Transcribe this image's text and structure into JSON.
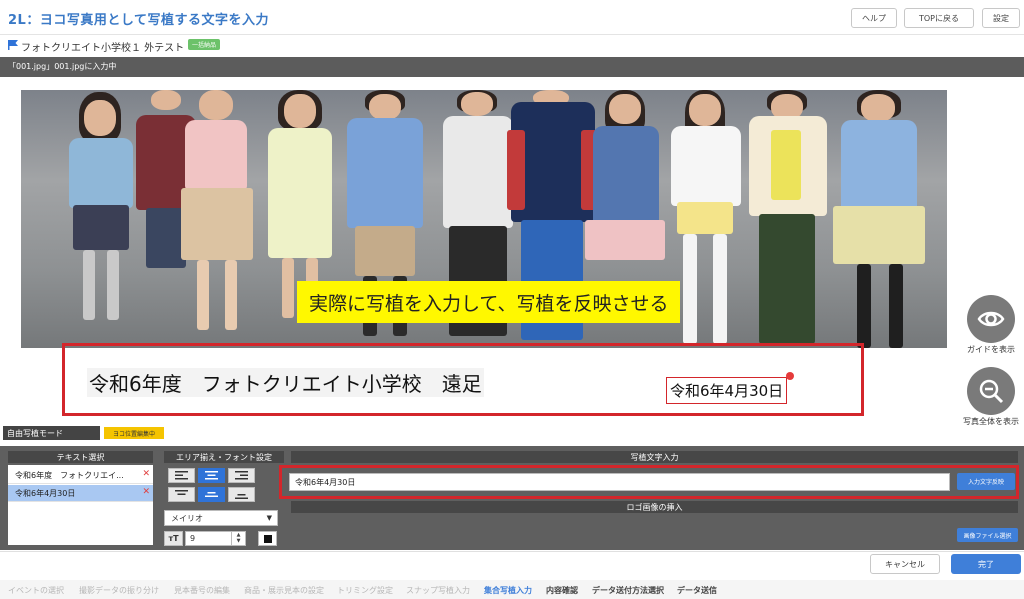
{
  "header": {
    "title": "2L：ヨコ写真用として写植する文字を入力",
    "help_label": "ヘルプ",
    "top_label": "TOPに戻る",
    "settings_label": "設定"
  },
  "subheader": {
    "course": "フォトクリエイト小学校１ 外テスト",
    "badge": "一括納品"
  },
  "filebar": {
    "text": "「001.jpg」001.jpgに入力中"
  },
  "preview": {
    "overlay_text": "実際に写植を入力して、写植を反映させる",
    "caption_main": "令和6年度　フォトクリエイト小学校　遠足",
    "caption_date": "令和6年4月30日"
  },
  "side_tools": {
    "guide_label": "ガイドを表示",
    "zoom_label": "写真全体を表示"
  },
  "mode": {
    "label": "自由写植モード",
    "badge": "ヨコ位置編集中"
  },
  "panel": {
    "text_select_header": "テキスト選択",
    "text_items": [
      "令和6年度　フォトクリエイ...",
      "令和6年4月30日"
    ],
    "area_header": "エリア揃え・フォント設定",
    "font": "メイリオ",
    "font_size": "9",
    "input_header": "写植文字入力",
    "input_value": "令和6年4月30日",
    "apply_label": "入力文字反映",
    "logo_header": "ロゴ画像の挿入",
    "file_label": "画像ファイル選択"
  },
  "footer": {
    "cancel_label": "キャンセル",
    "done_label": "完了",
    "steps": [
      "イベントの選択",
      "撮影データの振り分け",
      "見本番号の編集",
      "商品・展示見本の設定",
      "トリミング設定",
      "スナップ写植入力",
      "集合写植入力",
      "内容確認",
      "データ送付方法選択",
      "データ送信"
    ]
  },
  "colors": {
    "accent": "#3f7fd9",
    "highlight": "#d3262b",
    "overlay": "#fff800"
  },
  "icons": [
    "flag-icon",
    "eye-icon",
    "zoom-out-icon",
    "align-icons",
    "font-size-icon"
  ]
}
